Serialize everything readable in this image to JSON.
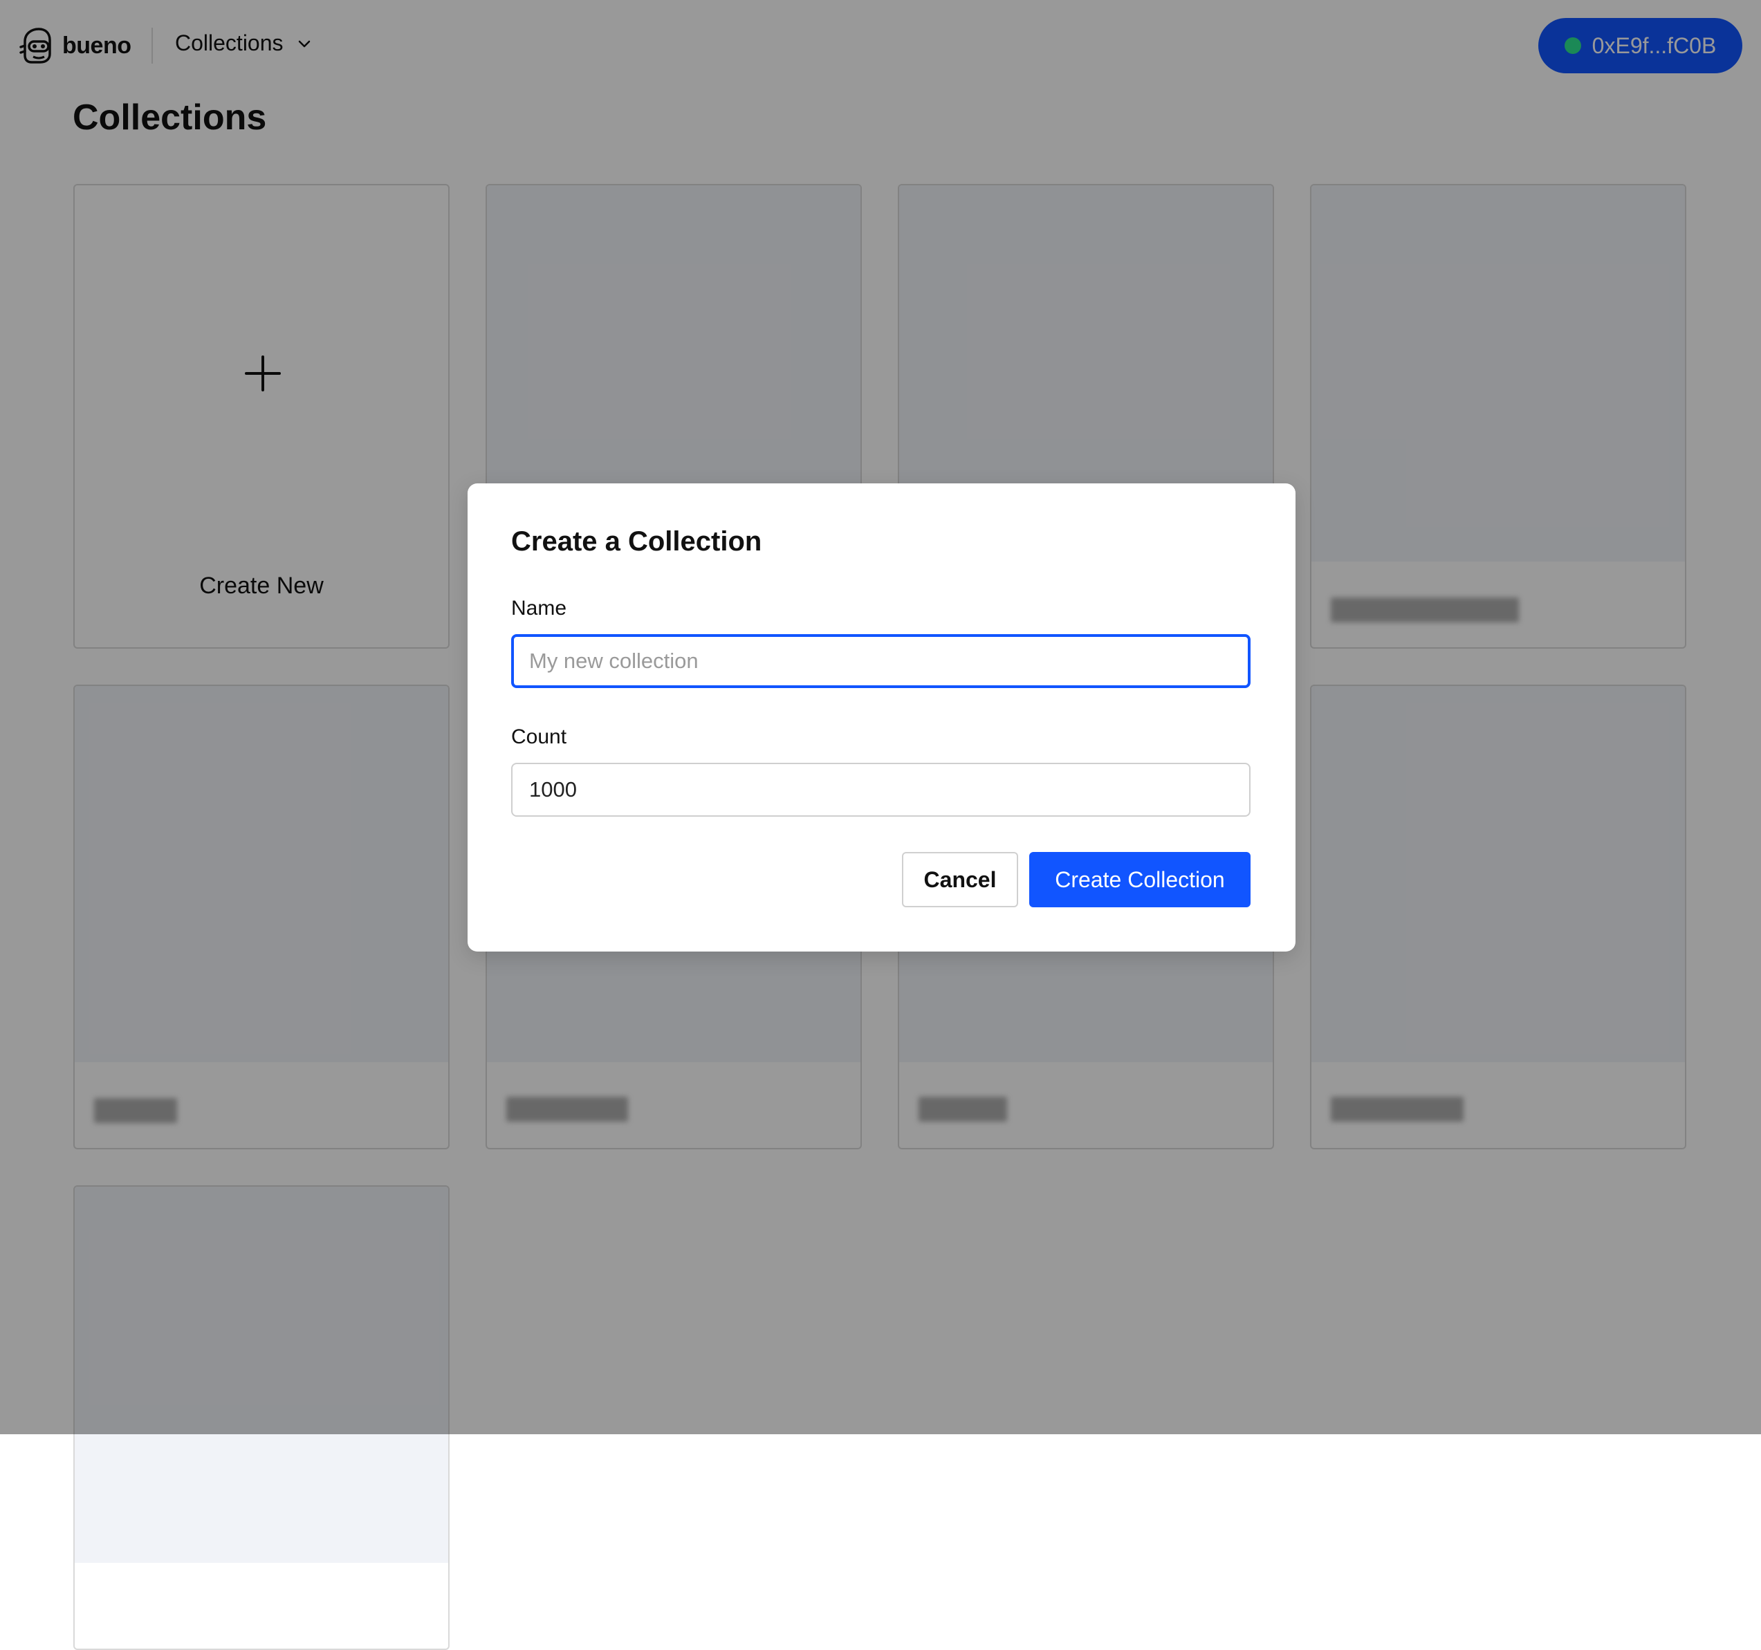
{
  "nav": {
    "brand": "bueno",
    "menu_label": "Collections",
    "wallet": "0xE9f...fC0B",
    "colors": {
      "accent": "#1155ff",
      "wallet_status": "#2ee58f"
    }
  },
  "page": {
    "title": "Collections"
  },
  "grid": {
    "create_label": "Create New"
  },
  "modal": {
    "title": "Create a Collection",
    "name_label": "Name",
    "name_placeholder": "My new collection",
    "name_value": "",
    "count_label": "Count",
    "count_value": "1000",
    "cancel_label": "Cancel",
    "submit_label": "Create Collection"
  }
}
